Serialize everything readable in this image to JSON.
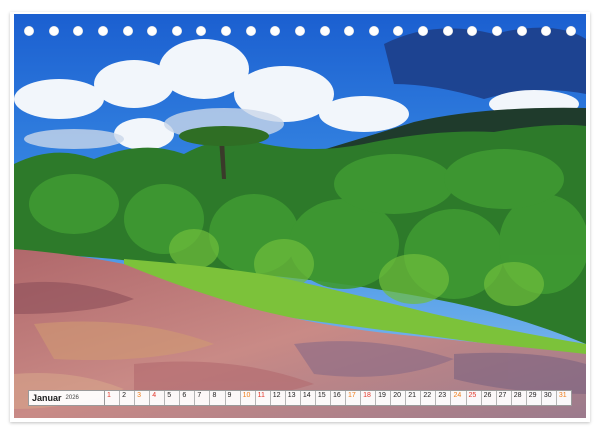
{
  "calendar": {
    "month": "Januar",
    "year": "2026",
    "days": [
      "1",
      "2",
      "3",
      "4",
      "5",
      "6",
      "7",
      "8",
      "9",
      "10",
      "11",
      "12",
      "13",
      "14",
      "15",
      "16",
      "17",
      "18",
      "19",
      "20",
      "21",
      "22",
      "23",
      "24",
      "25",
      "26",
      "27",
      "28",
      "29",
      "30",
      "31"
    ],
    "red_days": [
      "1",
      "4",
      "11",
      "18",
      "25"
    ],
    "orange_days": [
      "3",
      "10",
      "17",
      "24",
      "31"
    ]
  },
  "binding": {
    "hole_count": 23
  },
  "colors": {
    "red_day": "#e2362a",
    "orange_day": "#ef7d1a"
  }
}
